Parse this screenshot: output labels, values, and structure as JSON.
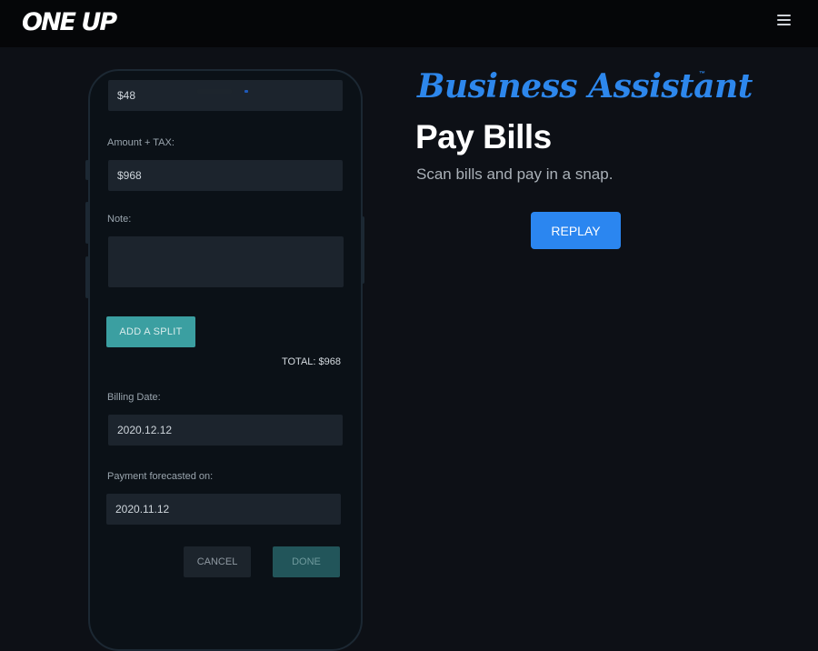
{
  "nav": {
    "logo": "ONE UP",
    "menu_icon": "hamburger-menu-icon"
  },
  "phone": {
    "top_amount": "$48",
    "amount_tax_label": "Amount + TAX:",
    "amount_tax_value": "$968",
    "note_label": "Note:",
    "note_value": "",
    "add_split_label": "ADD A SPLIT",
    "total_text": "TOTAL: $968",
    "billing_date_label": "Billing Date:",
    "billing_date_value": "2020.12.12",
    "payment_forecast_label": "Payment forecasted on:",
    "payment_forecast_value": "2020.11.12",
    "cancel_label": "CANCEL",
    "done_label": "DONE"
  },
  "hero": {
    "brand": "Business Assistant",
    "trademark": "™",
    "title": "Pay Bills",
    "subtitle": "Scan bills and pay in a snap.",
    "replay_label": "REPLAY"
  },
  "colors": {
    "accent": "#2b86f0",
    "teal": "#3b9fa1",
    "background": "#0d1016"
  }
}
